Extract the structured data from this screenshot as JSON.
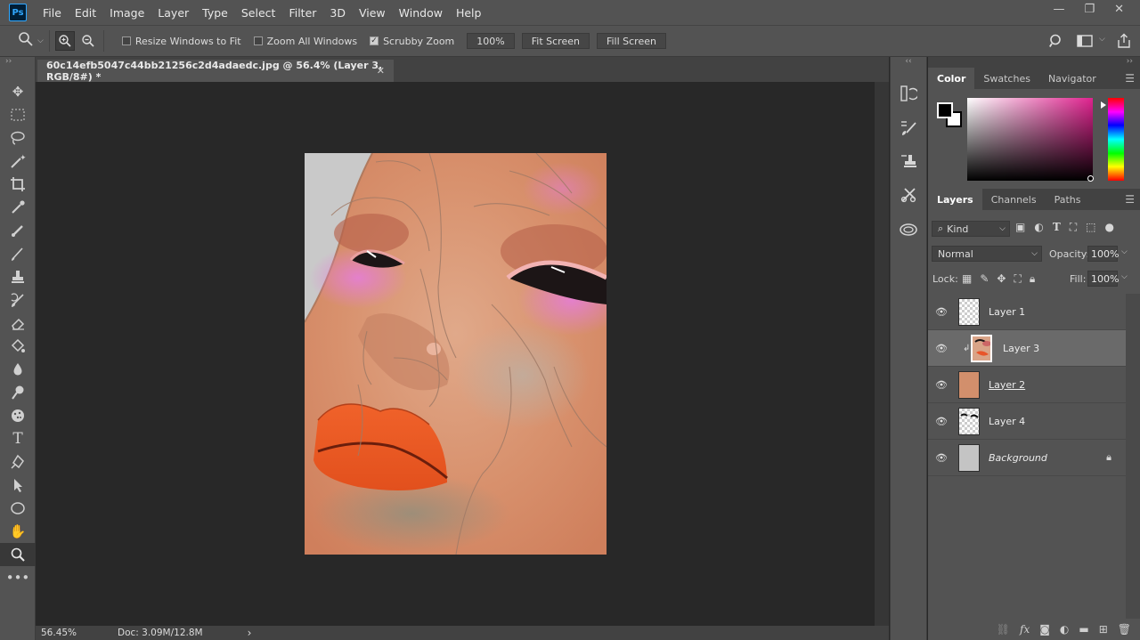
{
  "app": {
    "logo": "Ps"
  },
  "menu": [
    "File",
    "Edit",
    "Image",
    "Layer",
    "Type",
    "Select",
    "Filter",
    "3D",
    "View",
    "Window",
    "Help"
  ],
  "window_controls": {
    "minimize": "—",
    "restore": "❐",
    "close": "✕"
  },
  "options": {
    "resize_windows_label": "Resize Windows to Fit",
    "resize_windows_checked": false,
    "zoom_all_label": "Zoom All Windows",
    "zoom_all_checked": false,
    "scrubby_zoom_label": "Scrubby Zoom",
    "scrubby_zoom_checked": true,
    "zoom_100_label": "100%",
    "fit_screen_label": "Fit Screen",
    "fill_screen_label": "Fill Screen"
  },
  "document": {
    "tab_title": "60c14efb5047c44bb21256c2d4adaedc.jpg @ 56.4% (Layer 3, RGB/8#) *",
    "close_glyph": "✕",
    "zoom_readout": "56.45%",
    "doc_size": "Doc: 3.09M/12.8M",
    "status_arrow": "›"
  },
  "tools": [
    "move-tool-icon",
    "marquee-tool-icon",
    "lasso-tool-icon",
    "magic-wand-icon",
    "crop-tool-icon",
    "eyedropper-icon",
    "healing-brush-icon",
    "brush-tool-icon",
    "clone-stamp-icon",
    "history-brush-icon",
    "eraser-icon",
    "paint-bucket-icon",
    "blur-tool-icon",
    "dodge-tool-icon",
    "sponge-icon",
    "type-tool-icon",
    "pen-tool-icon",
    "path-select-icon",
    "ellipse-tool-icon",
    "hand-tool-icon",
    "zoom-tool-icon",
    "more-tools-icon"
  ],
  "color_panel": {
    "tabs": [
      "Color",
      "Swatches",
      "Navigator"
    ],
    "active_tab": "Color",
    "foreground": "#000000",
    "background": "#ffffff",
    "hue_color": "#e0238f"
  },
  "layers_panel": {
    "tabs": [
      "Layers",
      "Channels",
      "Paths"
    ],
    "active_tab": "Layers",
    "filter_label": "Kind",
    "blend_mode": "Normal",
    "opacity_label": "Opacity:",
    "opacity_value": "100%",
    "lock_label": "Lock:",
    "fill_label": "Fill:",
    "fill_value": "100%",
    "layers": [
      {
        "name": "Layer 1",
        "thumb": "transparent",
        "selected": false,
        "clipped": false,
        "italic": false,
        "underline": false,
        "locked": false
      },
      {
        "name": "Layer 3",
        "thumb": "face",
        "selected": true,
        "clipped": true,
        "italic": false,
        "underline": false,
        "locked": false
      },
      {
        "name": "Layer 2",
        "thumb": "#d28f6c",
        "selected": false,
        "clipped": false,
        "italic": false,
        "underline": true,
        "locked": false
      },
      {
        "name": "Layer 4",
        "thumb": "transparent-eyes",
        "selected": false,
        "clipped": false,
        "italic": false,
        "underline": false,
        "locked": false
      },
      {
        "name": "Background",
        "thumb": "#c4c4c4",
        "selected": false,
        "clipped": false,
        "italic": true,
        "underline": false,
        "locked": true
      }
    ]
  },
  "artwork": {
    "skin": "#d98e6a",
    "bg_gray": "#c9c9c9",
    "lips": "#ef5a22",
    "eye_dark": "#1c1516",
    "blush": "#e07bd0"
  }
}
